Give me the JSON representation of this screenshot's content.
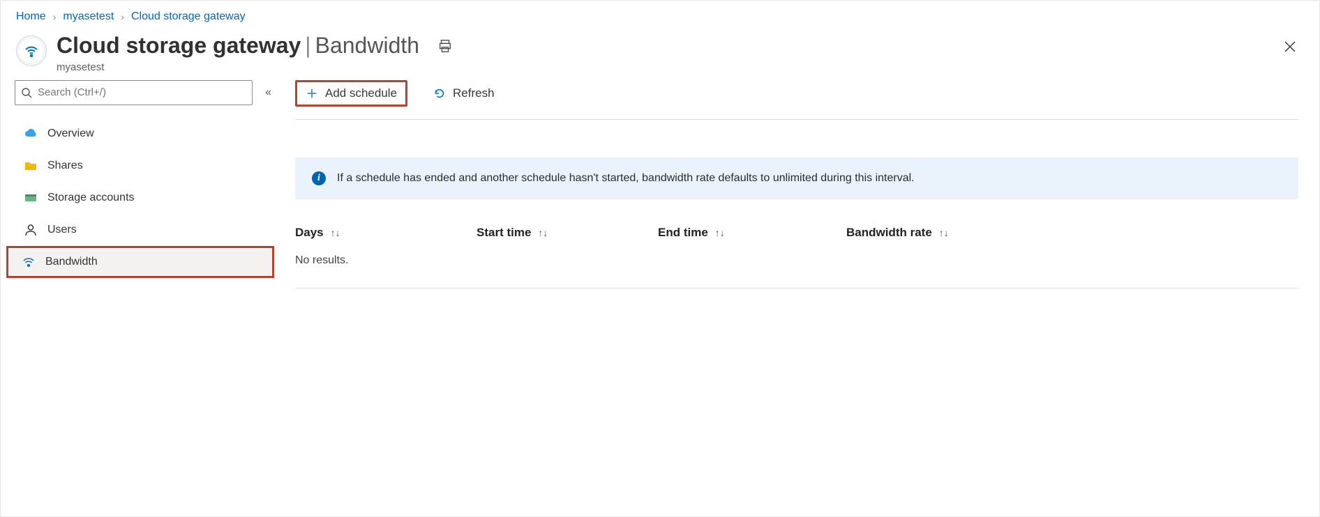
{
  "breadcrumb": [
    {
      "label": "Home"
    },
    {
      "label": "myasetest"
    },
    {
      "label": "Cloud storage gateway"
    }
  ],
  "header": {
    "title_main": "Cloud storage gateway",
    "title_section": "Bandwidth",
    "subtitle": "myasetest"
  },
  "sidebar": {
    "search_placeholder": "Search (Ctrl+/)",
    "items": [
      {
        "icon": "cloud",
        "label": "Overview"
      },
      {
        "icon": "folder",
        "label": "Shares"
      },
      {
        "icon": "storage",
        "label": "Storage accounts"
      },
      {
        "icon": "user",
        "label": "Users"
      },
      {
        "icon": "wifi",
        "label": "Bandwidth",
        "active": true,
        "highlight": true
      }
    ]
  },
  "toolbar": {
    "add_label": "Add schedule",
    "refresh_label": "Refresh"
  },
  "info_message": "If a schedule has ended and another schedule hasn't started, bandwidth rate defaults to unlimited during this interval.",
  "table": {
    "columns": [
      "Days",
      "Start time",
      "End time",
      "Bandwidth rate"
    ],
    "rows": [],
    "empty_text": "No results."
  },
  "highlight_color": "#b04632"
}
